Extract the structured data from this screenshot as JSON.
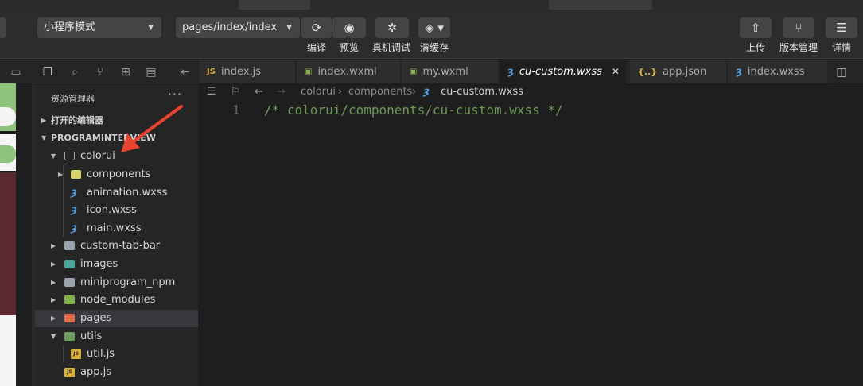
{
  "toolbar": {
    "mode_select": "小程序模式",
    "path_select": "pages/index/index",
    "buttons": [
      {
        "label": "编译",
        "icon": "refresh-icon"
      },
      {
        "label": "预览",
        "icon": "eye-icon"
      },
      {
        "label": "真机调试",
        "icon": "bug-icon"
      },
      {
        "label": "清缓存",
        "icon": "layers-icon"
      }
    ],
    "right_buttons": [
      {
        "label": "上传",
        "icon": "upload-icon"
      },
      {
        "label": "版本管理",
        "icon": "branch-icon"
      },
      {
        "label": "详情",
        "icon": "menu-icon"
      }
    ]
  },
  "tabs": [
    {
      "label": "index.js",
      "type": "js"
    },
    {
      "label": "index.wxml",
      "type": "wxml"
    },
    {
      "label": "my.wxml",
      "type": "wxml"
    },
    {
      "label": "cu-custom.wxss",
      "type": "wxss",
      "active": true
    },
    {
      "label": "app.json",
      "type": "json"
    },
    {
      "label": "index.wxss",
      "type": "wxss"
    }
  ],
  "explorer": {
    "title": "资源管理器",
    "open_editors": "打开的编辑器",
    "project": "PROGRAMINTERVIEW",
    "tree": [
      {
        "label": "colorui",
        "kind": "folder-open"
      },
      {
        "label": "components",
        "kind": "comp"
      },
      {
        "label": "animation.wxss",
        "kind": "css"
      },
      {
        "label": "icon.wxss",
        "kind": "css"
      },
      {
        "label": "main.wxss",
        "kind": "css"
      },
      {
        "label": "custom-tab-bar",
        "kind": "folder"
      },
      {
        "label": "images",
        "kind": "img"
      },
      {
        "label": "miniprogram_npm",
        "kind": "folder"
      },
      {
        "label": "node_modules",
        "kind": "node"
      },
      {
        "label": "pages",
        "kind": "pages"
      },
      {
        "label": "utils",
        "kind": "utils"
      },
      {
        "label": "util.js",
        "kind": "js"
      },
      {
        "label": "app.js",
        "kind": "js"
      }
    ]
  },
  "breadcrumb": [
    "colorui",
    "components",
    "cu-custom.wxss"
  ],
  "editor": {
    "line_number": "1",
    "code": "/* colorui/components/cu-custom.wxss */"
  },
  "file_badges": {
    "js": "JS"
  },
  "colors": {
    "accent": "#4f9fe6",
    "comment": "#6a9955",
    "arrow": "#e8432f"
  }
}
